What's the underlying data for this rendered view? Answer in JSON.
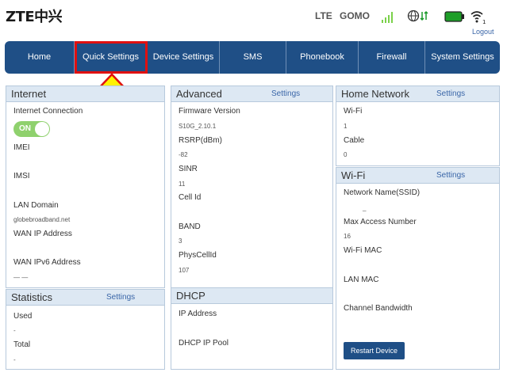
{
  "header": {
    "logo": "ZTE中兴",
    "network_type": "LTE",
    "carrier": "GOMO",
    "logout": "Logout",
    "wifi_count": "1"
  },
  "nav": {
    "items": [
      "Home",
      "Quick Settings",
      "Device Settings",
      "SMS",
      "Phonebook",
      "Firewall",
      "System Settings"
    ],
    "highlighted": "Quick Settings"
  },
  "internet": {
    "title": "Internet",
    "connection_label": "Internet Connection",
    "toggle": "ON",
    "imei_label": "IMEI",
    "imsi_label": "IMSI",
    "lan_domain_label": "LAN Domain",
    "lan_domain_value": "globebroadband.net",
    "wan_ip_label": "WAN IP Address",
    "wan_ipv6_label": "WAN IPv6 Address",
    "wan_ipv6_value": "— —"
  },
  "statistics": {
    "title": "Statistics",
    "settings": "Settings",
    "used_label": "Used",
    "used_value": "-",
    "total_label": "Total",
    "total_value": "-"
  },
  "advanced": {
    "title": "Advanced",
    "settings": "Settings",
    "firmware_label": "Firmware Version",
    "firmware_value": "S10G_2.10.1",
    "rsrp_label": "RSRP(dBm)",
    "rsrp_value": "-82",
    "sinr_label": "SINR",
    "sinr_value": "11",
    "cellid_label": "Cell Id",
    "band_label": "BAND",
    "band_value": "3",
    "physcellid_label": "PhysCellId",
    "physcellid_value": "107"
  },
  "dhcp": {
    "title": "DHCP",
    "ip_label": "IP Address",
    "pool_label": "DHCP IP Pool"
  },
  "home_network": {
    "title": "Home Network",
    "settings": "Settings",
    "wifi_label": "Wi-Fi",
    "wifi_value": "1",
    "cable_label": "Cable",
    "cable_value": "0"
  },
  "wifi": {
    "title": "Wi-Fi",
    "settings": "Settings",
    "ssid_label": "Network Name(SSID)",
    "ssid_value": "_",
    "max_access_label": "Max Access Number",
    "max_access_value": "16",
    "mac_label": "Wi-Fi MAC",
    "lan_mac_label": "LAN MAC",
    "bandwidth_label": "Channel Bandwidth",
    "restart": "Restart Device"
  }
}
